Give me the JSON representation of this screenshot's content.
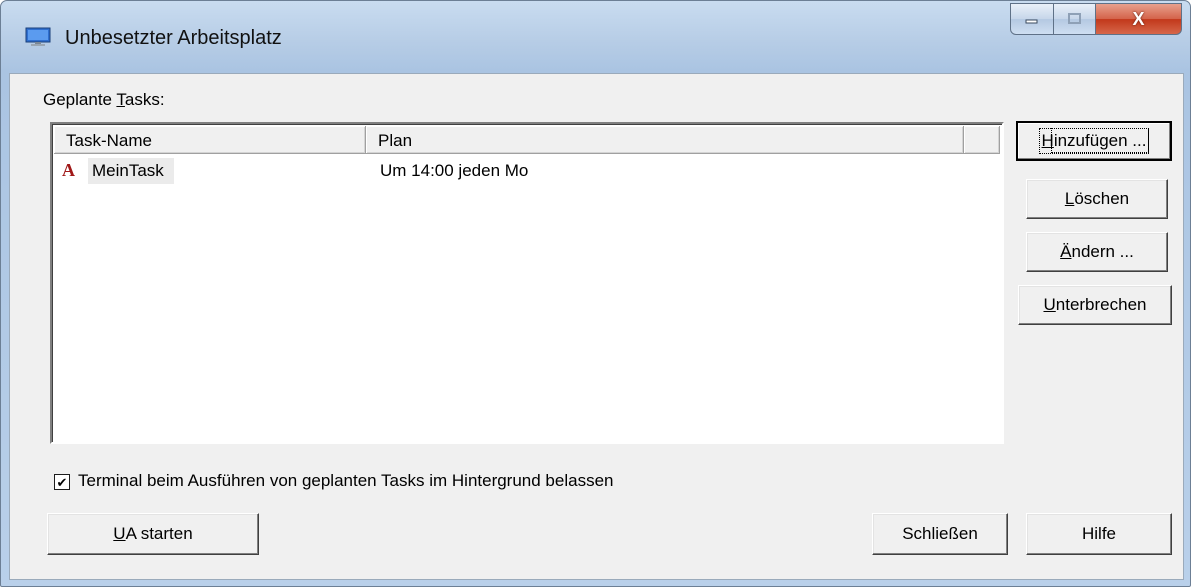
{
  "window": {
    "title": "Unbesetzter Arbeitsplatz",
    "close_glyph": "X"
  },
  "tasks": {
    "label_pre": "Geplante ",
    "label_key": "T",
    "label_post": "asks:",
    "columns": [
      "Task-Name",
      "Plan"
    ],
    "rows": [
      {
        "icon": "A",
        "name": "MeinTask",
        "plan": "Um 14:00 jeden Mo"
      }
    ]
  },
  "buttons": {
    "add": {
      "key": "H",
      "rest": "inzufügen ..."
    },
    "delete": {
      "key": "L",
      "rest": "öschen"
    },
    "edit": {
      "key": "Ä",
      "rest": "ndern ..."
    },
    "pause": {
      "key": "U",
      "rest": "nterbrechen"
    },
    "start_ua": {
      "key": "U",
      "rest": "A starten"
    },
    "close": "Schließen",
    "help": "Hilfe"
  },
  "background_option": {
    "checked": true,
    "mark": "✔",
    "label": "Terminal beim Ausführen von geplanten Tasks im Hintergrund belassen"
  },
  "colors": {
    "task_icon": "#a01818",
    "title_bar": "#b7cde6",
    "close_button": "#c2381b"
  }
}
